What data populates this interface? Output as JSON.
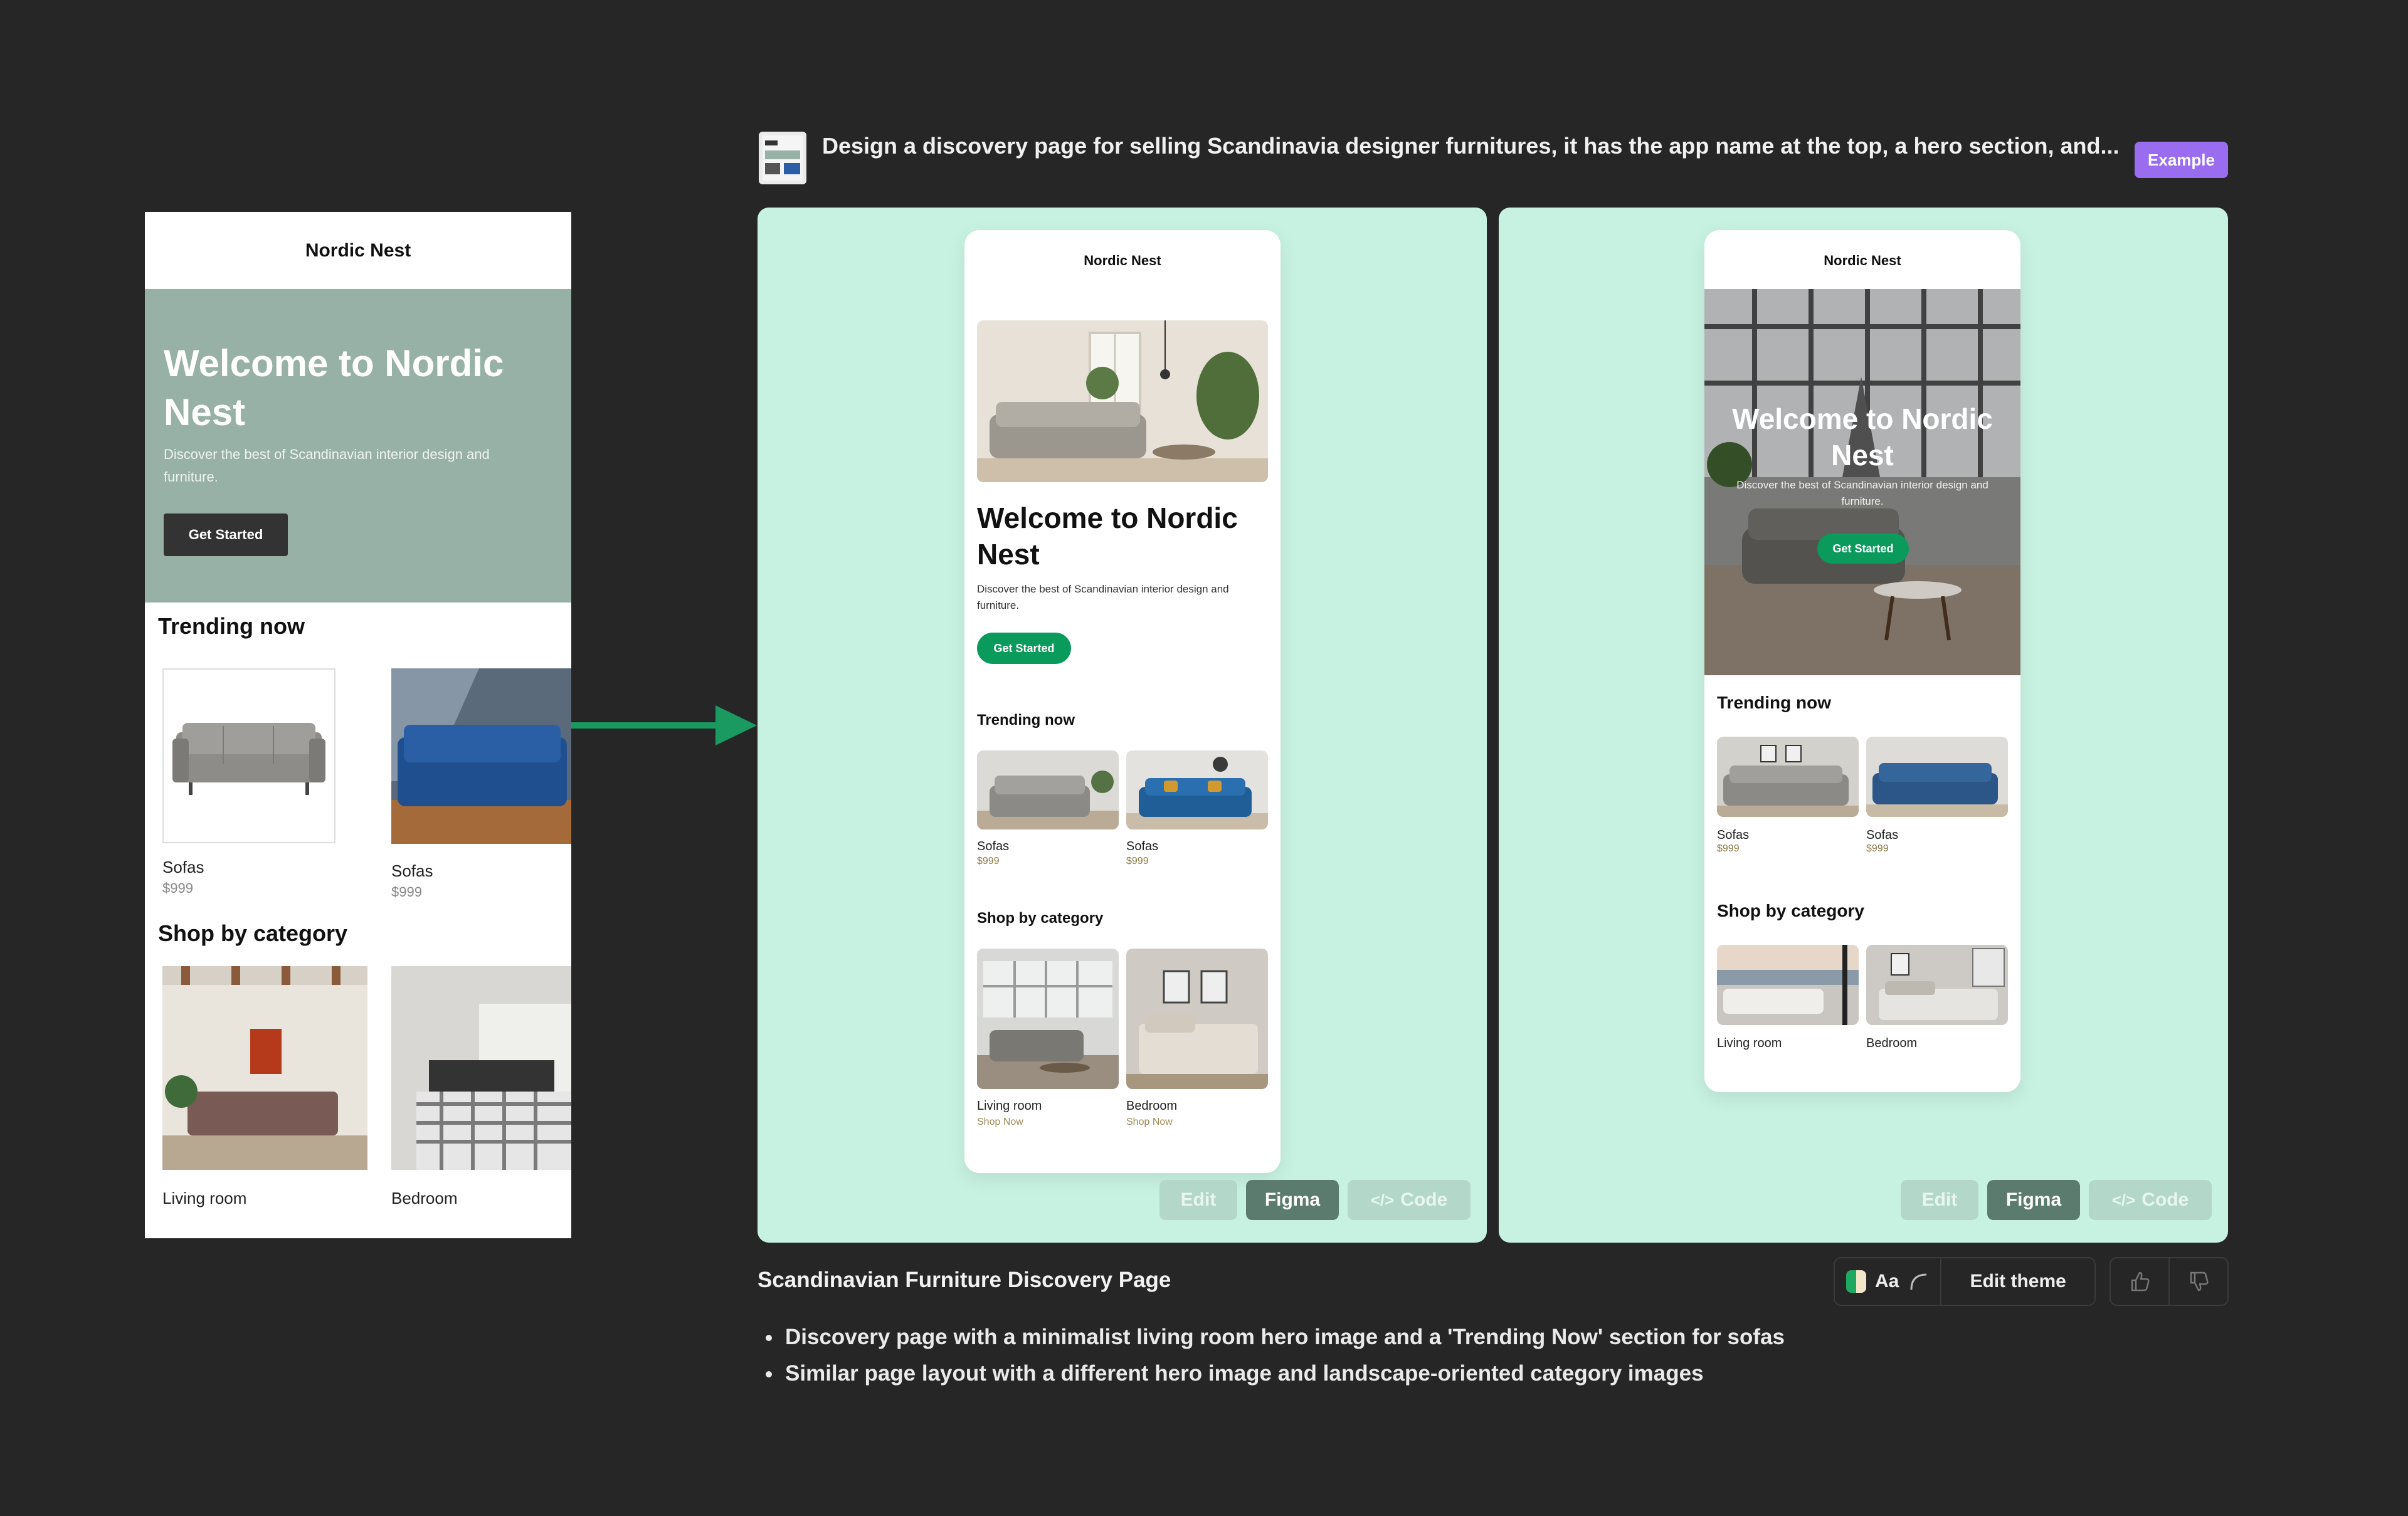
{
  "source_mockup": {
    "app_name": "Nordic Nest",
    "hero": {
      "title": "Welcome to Nordic Nest",
      "subtitle": "Discover the best of Scandinavian interior design and furniture.",
      "button": "Get Started"
    },
    "trending_title": "Trending now",
    "trending": [
      {
        "name": "Sofas",
        "price": "$999"
      },
      {
        "name": "Sofas",
        "price": "$999"
      }
    ],
    "category_title": "Shop by category",
    "categories": [
      {
        "name": "Living room"
      },
      {
        "name": "Bedroom"
      }
    ]
  },
  "prompt": {
    "text": "Design a discovery page for selling Scandinavia designer furnitures, it has the app name at the top, a hero section, and...",
    "badge": "Example"
  },
  "variants": [
    {
      "app_name": "Nordic Nest",
      "hero_title": "Welcome to Nordic Nest",
      "hero_subtitle": "Discover the best of Scandinavian interior design and furniture.",
      "hero_button": "Get Started",
      "trending_title": "Trending now",
      "trending": [
        {
          "name": "Sofas",
          "price": "$999"
        },
        {
          "name": "Sofas",
          "price": "$999"
        }
      ],
      "category_title": "Shop by category",
      "categories": [
        {
          "name": "Living room",
          "cta": "Shop Now"
        },
        {
          "name": "Bedroom",
          "cta": "Shop Now"
        }
      ],
      "buttons": {
        "edit": "Edit",
        "figma": "Figma",
        "code": "Code"
      }
    },
    {
      "app_name": "Nordic Nest",
      "hero_title": "Welcome to Nordic Nest",
      "hero_subtitle": "Discover the best of Scandinavian interior design and furniture.",
      "hero_button": "Get Started",
      "trending_title": "Trending now",
      "trending": [
        {
          "name": "Sofas",
          "price": "$999"
        },
        {
          "name": "Sofas",
          "price": "$999"
        }
      ],
      "category_title": "Shop by category",
      "categories": [
        {
          "name": "Living room"
        },
        {
          "name": "Bedroom"
        }
      ],
      "buttons": {
        "edit": "Edit",
        "figma": "Figma",
        "code": "Code"
      }
    }
  ],
  "result": {
    "title": "Scandinavian Furniture Discovery Page",
    "theme_aa": "Aa",
    "edit_theme": "Edit theme",
    "bullets": [
      "Discovery page with a minimalist living room hero image and a 'Trending Now' section for sofas",
      "Similar page layout with a different hero image and landscape-oriented category images"
    ]
  },
  "colors": {
    "background": "#262626",
    "panel": "#c7f1e1",
    "accent_green": "#0a9a5c",
    "badge_purple": "#9a6cf0",
    "source_hero": "#98b1a7"
  }
}
